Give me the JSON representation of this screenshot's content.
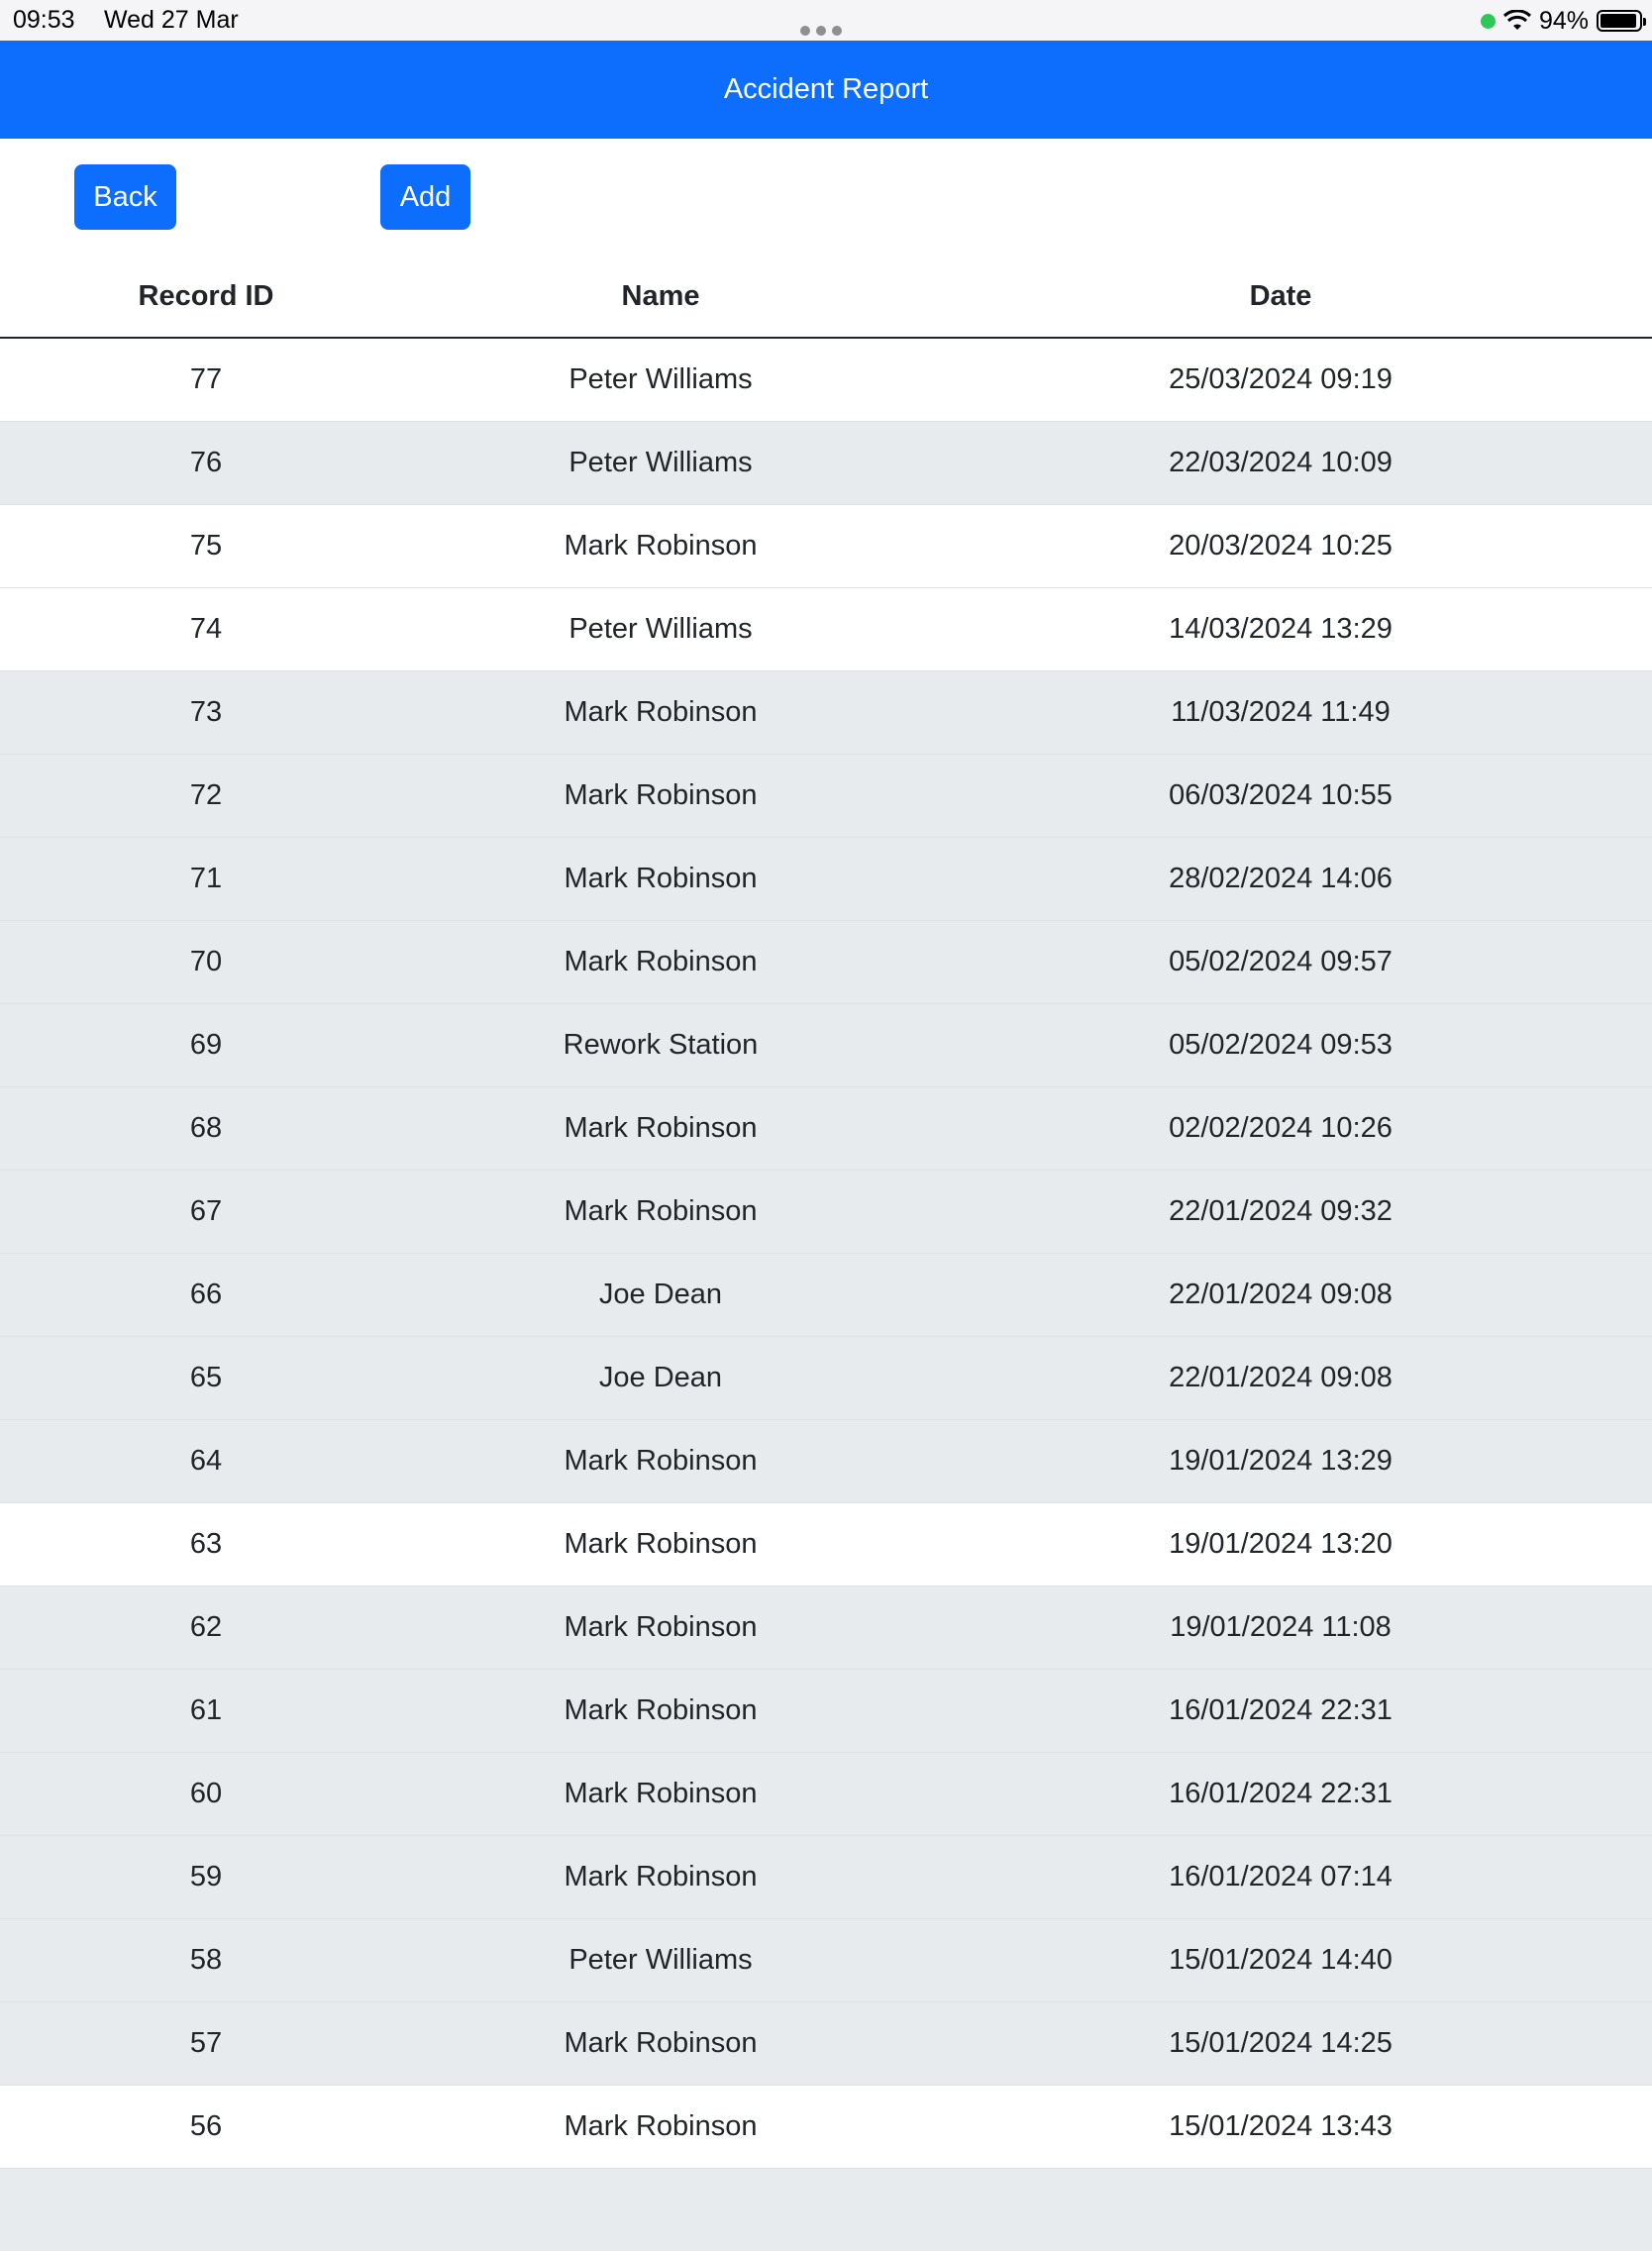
{
  "status_bar": {
    "time": "09:53",
    "date": "Wed 27 Mar",
    "battery": "94%",
    "battery_level": 0.94
  },
  "header": {
    "title": "Accident Report"
  },
  "toolbar": {
    "back_label": "Back",
    "add_label": "Add"
  },
  "table": {
    "columns": [
      "Record ID",
      "Name",
      "Date"
    ],
    "rows": [
      {
        "id": "77",
        "name": "Peter Williams",
        "date": "25/03/2024 09:19",
        "shade": "white"
      },
      {
        "id": "76",
        "name": "Peter Williams",
        "date": "22/03/2024 10:09",
        "shade": "gray"
      },
      {
        "id": "75",
        "name": "Mark Robinson",
        "date": "20/03/2024 10:25",
        "shade": "white"
      },
      {
        "id": "74",
        "name": "Peter Williams",
        "date": "14/03/2024 13:29",
        "shade": "white"
      },
      {
        "id": "73",
        "name": "Mark Robinson",
        "date": "11/03/2024 11:49",
        "shade": "gray"
      },
      {
        "id": "72",
        "name": "Mark Robinson",
        "date": "06/03/2024 10:55",
        "shade": "gray"
      },
      {
        "id": "71",
        "name": "Mark Robinson",
        "date": "28/02/2024 14:06",
        "shade": "gray"
      },
      {
        "id": "70",
        "name": "Mark Robinson",
        "date": "05/02/2024 09:57",
        "shade": "gray"
      },
      {
        "id": "69",
        "name": "Rework Station",
        "date": "05/02/2024 09:53",
        "shade": "gray"
      },
      {
        "id": "68",
        "name": "Mark Robinson",
        "date": "02/02/2024 10:26",
        "shade": "gray"
      },
      {
        "id": "67",
        "name": "Mark Robinson",
        "date": "22/01/2024 09:32",
        "shade": "gray"
      },
      {
        "id": "66",
        "name": "Joe Dean",
        "date": "22/01/2024 09:08",
        "shade": "gray"
      },
      {
        "id": "65",
        "name": "Joe Dean",
        "date": "22/01/2024 09:08",
        "shade": "gray"
      },
      {
        "id": "64",
        "name": "Mark Robinson",
        "date": "19/01/2024 13:29",
        "shade": "gray"
      },
      {
        "id": "63",
        "name": "Mark Robinson",
        "date": "19/01/2024 13:20",
        "shade": "white"
      },
      {
        "id": "62",
        "name": "Mark Robinson",
        "date": "19/01/2024 11:08",
        "shade": "gray"
      },
      {
        "id": "61",
        "name": "Mark Robinson",
        "date": "16/01/2024 22:31",
        "shade": "gray"
      },
      {
        "id": "60",
        "name": "Mark Robinson",
        "date": "16/01/2024 22:31",
        "shade": "gray"
      },
      {
        "id": "59",
        "name": "Mark Robinson",
        "date": "16/01/2024 07:14",
        "shade": "gray"
      },
      {
        "id": "58",
        "name": "Peter Williams",
        "date": "15/01/2024 14:40",
        "shade": "gray"
      },
      {
        "id": "57",
        "name": "Mark Robinson",
        "date": "15/01/2024 14:25",
        "shade": "gray"
      },
      {
        "id": "56",
        "name": "Mark Robinson",
        "date": "15/01/2024 13:43",
        "shade": "white"
      },
      {
        "id": "",
        "name": "",
        "date": "",
        "shade": "gray"
      }
    ]
  },
  "colors": {
    "primary": "#0d6efd",
    "row_gray": "#e8ebee",
    "row_white": "#ffffff",
    "status_green": "#30c759"
  }
}
